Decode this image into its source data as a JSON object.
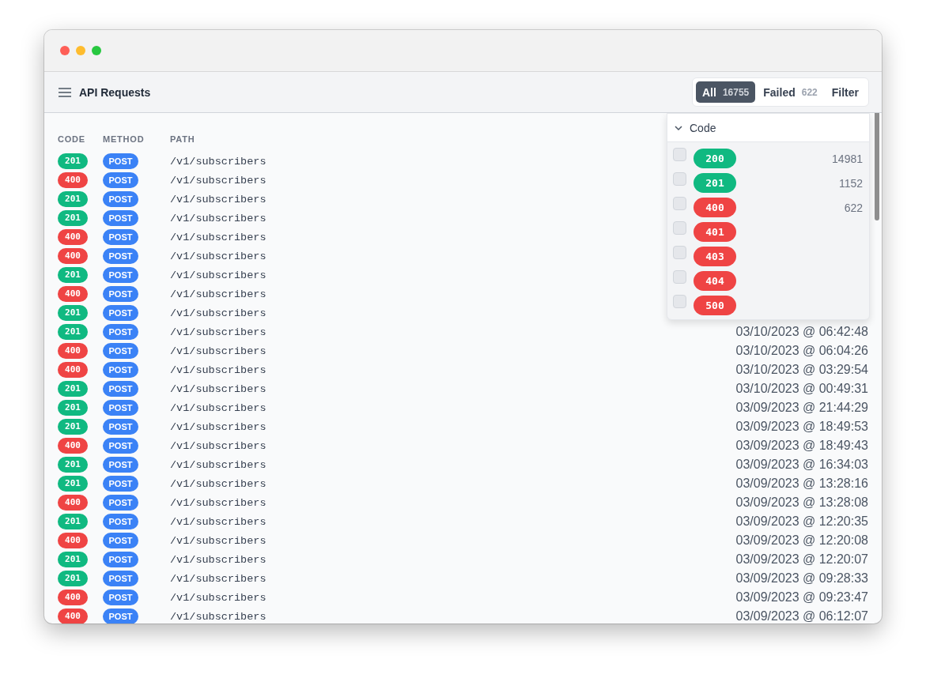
{
  "header": {
    "title": "API Requests"
  },
  "segments": [
    {
      "label": "All",
      "count": "16755",
      "selected": true
    },
    {
      "label": "Failed",
      "count": "622",
      "selected": false
    },
    {
      "label": "Filter",
      "selected": false
    }
  ],
  "table": {
    "columns": [
      "CODE",
      "METHOD",
      "PATH"
    ],
    "rows": [
      {
        "code": "201",
        "color": "#10b981",
        "method": "POST",
        "path": "/v1/subscribers"
      },
      {
        "code": "400",
        "color": "#ef4444",
        "method": "POST",
        "path": "/v1/subscribers"
      },
      {
        "code": "201",
        "color": "#10b981",
        "method": "POST",
        "path": "/v1/subscribers"
      },
      {
        "code": "201",
        "color": "#10b981",
        "method": "POST",
        "path": "/v1/subscribers"
      },
      {
        "code": "400",
        "color": "#ef4444",
        "method": "POST",
        "path": "/v1/subscribers"
      },
      {
        "code": "400",
        "color": "#ef4444",
        "method": "POST",
        "path": "/v1/subscribers"
      },
      {
        "code": "201",
        "color": "#10b981",
        "method": "POST",
        "path": "/v1/subscribers"
      },
      {
        "code": "400",
        "color": "#ef4444",
        "method": "POST",
        "path": "/v1/subscribers"
      },
      {
        "code": "201",
        "color": "#10b981",
        "method": "POST",
        "path": "/v1/subscribers"
      },
      {
        "code": "201",
        "color": "#10b981",
        "method": "POST",
        "path": "/v1/subscribers",
        "time": "03/10/2023 @ 06:42:48"
      },
      {
        "code": "400",
        "color": "#ef4444",
        "method": "POST",
        "path": "/v1/subscribers",
        "time": "03/10/2023 @ 06:04:26"
      },
      {
        "code": "400",
        "color": "#ef4444",
        "method": "POST",
        "path": "/v1/subscribers",
        "time": "03/10/2023 @ 03:29:54"
      },
      {
        "code": "201",
        "color": "#10b981",
        "method": "POST",
        "path": "/v1/subscribers",
        "time": "03/10/2023 @ 00:49:31"
      },
      {
        "code": "201",
        "color": "#10b981",
        "method": "POST",
        "path": "/v1/subscribers",
        "time": "03/09/2023 @ 21:44:29"
      },
      {
        "code": "201",
        "color": "#10b981",
        "method": "POST",
        "path": "/v1/subscribers",
        "time": "03/09/2023 @ 18:49:53"
      },
      {
        "code": "400",
        "color": "#ef4444",
        "method": "POST",
        "path": "/v1/subscribers",
        "time": "03/09/2023 @ 18:49:43"
      },
      {
        "code": "201",
        "color": "#10b981",
        "method": "POST",
        "path": "/v1/subscribers",
        "time": "03/09/2023 @ 16:34:03"
      },
      {
        "code": "201",
        "color": "#10b981",
        "method": "POST",
        "path": "/v1/subscribers",
        "time": "03/09/2023 @ 13:28:16"
      },
      {
        "code": "400",
        "color": "#ef4444",
        "method": "POST",
        "path": "/v1/subscribers",
        "time": "03/09/2023 @ 13:28:08"
      },
      {
        "code": "201",
        "color": "#10b981",
        "method": "POST",
        "path": "/v1/subscribers",
        "time": "03/09/2023 @ 12:20:35"
      },
      {
        "code": "400",
        "color": "#ef4444",
        "method": "POST",
        "path": "/v1/subscribers",
        "time": "03/09/2023 @ 12:20:08"
      },
      {
        "code": "201",
        "color": "#10b981",
        "method": "POST",
        "path": "/v1/subscribers",
        "time": "03/09/2023 @ 12:20:07"
      },
      {
        "code": "201",
        "color": "#10b981",
        "method": "POST",
        "path": "/v1/subscribers",
        "time": "03/09/2023 @ 09:28:33"
      },
      {
        "code": "400",
        "color": "#ef4444",
        "method": "POST",
        "path": "/v1/subscribers",
        "time": "03/09/2023 @ 09:23:47"
      },
      {
        "code": "400",
        "color": "#ef4444",
        "method": "POST",
        "path": "/v1/subscribers",
        "time": "03/09/2023 @ 06:12:07"
      }
    ]
  },
  "filter_panel": {
    "title": "Code",
    "expanded": true,
    "options": [
      {
        "code": "200",
        "color": "#10b981",
        "count": "14981",
        "checked": false
      },
      {
        "code": "201",
        "color": "#10b981",
        "count": "1152",
        "checked": false
      },
      {
        "code": "400",
        "color": "#ef4444",
        "count": "622",
        "checked": false
      },
      {
        "code": "401",
        "color": "#ef4444",
        "checked": false
      },
      {
        "code": "403",
        "color": "#ef4444",
        "checked": false
      },
      {
        "code": "404",
        "color": "#ef4444",
        "checked": false
      },
      {
        "code": "500",
        "color": "#ef4444",
        "checked": false
      }
    ]
  }
}
